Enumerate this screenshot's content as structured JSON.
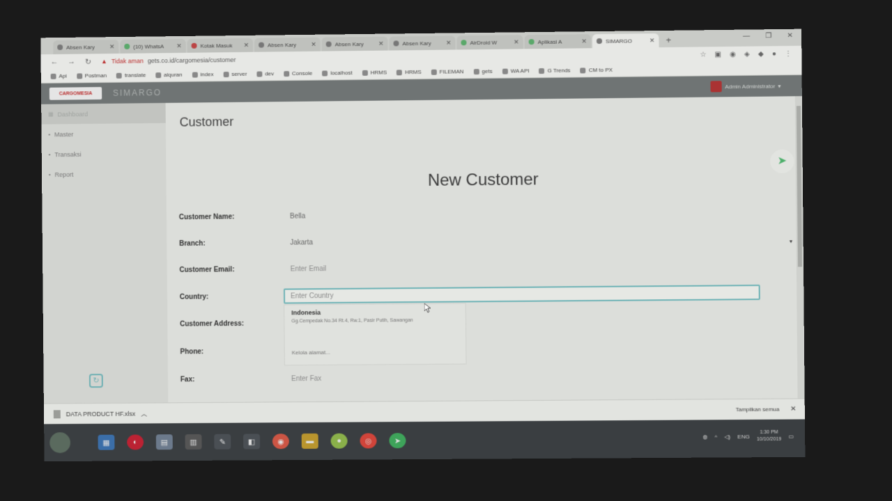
{
  "browser": {
    "tabs": [
      {
        "label": "Absen Kary",
        "active": false
      },
      {
        "label": "(10) WhatsA",
        "active": false
      },
      {
        "label": "Kotak Masuk",
        "active": false
      },
      {
        "label": "Absen Kary",
        "active": false
      },
      {
        "label": "Absen Kary",
        "active": false
      },
      {
        "label": "Absen Kary",
        "active": false
      },
      {
        "label": "AirDroid W",
        "active": false
      },
      {
        "label": "Aplikasi A",
        "active": false
      },
      {
        "label": "SIMARGO",
        "active": true
      }
    ],
    "new_tab": "+",
    "security_warning": "Tidak aman",
    "url": "gets.co.id/cargomesia/customer",
    "bookmarks": [
      "Api",
      "Postman",
      "translate",
      "alquran",
      "index",
      "server",
      "dev",
      "Console",
      "localhost",
      "HRMS",
      "HRMS",
      "FILEMAN",
      "gets",
      "WA API",
      "G Trends",
      "CM to PX"
    ]
  },
  "app": {
    "logo_text": "CARGOMESIA",
    "name": "SIMARGO",
    "user_label": "Admin Administrator"
  },
  "sidebar": {
    "items": [
      {
        "label": "Dashboard"
      },
      {
        "label": "Master"
      },
      {
        "label": "Transaksi"
      },
      {
        "label": "Report"
      }
    ]
  },
  "page": {
    "title": "Customer",
    "form_title": "New Customer",
    "fields": {
      "customer_name": {
        "label": "Customer Name:",
        "value": "Bella"
      },
      "branch": {
        "label": "Branch:",
        "value": "Jakarta"
      },
      "customer_email": {
        "label": "Customer Email:",
        "placeholder": "Enter Email"
      },
      "country": {
        "label": "Country:",
        "placeholder": "Enter Country"
      },
      "customer_address": {
        "label": "Customer Address:"
      },
      "phone": {
        "label": "Phone:"
      },
      "fax": {
        "label": "Fax:",
        "placeholder": "Enter Fax"
      }
    },
    "autocomplete": {
      "name": "Indonesia",
      "address": "Gg.Cempedak No.34 Rt.4, Rw.1, Pasir Putih, Sawangan",
      "manage": "Kelola alamat..."
    }
  },
  "downloads": {
    "file": "DATA PRODUCT HF.xlsx",
    "show_all": "Tampilkan semua"
  },
  "taskbar": {
    "tray_lang": "ENG",
    "time": "1:30 PM",
    "date": "10/10/2019"
  }
}
